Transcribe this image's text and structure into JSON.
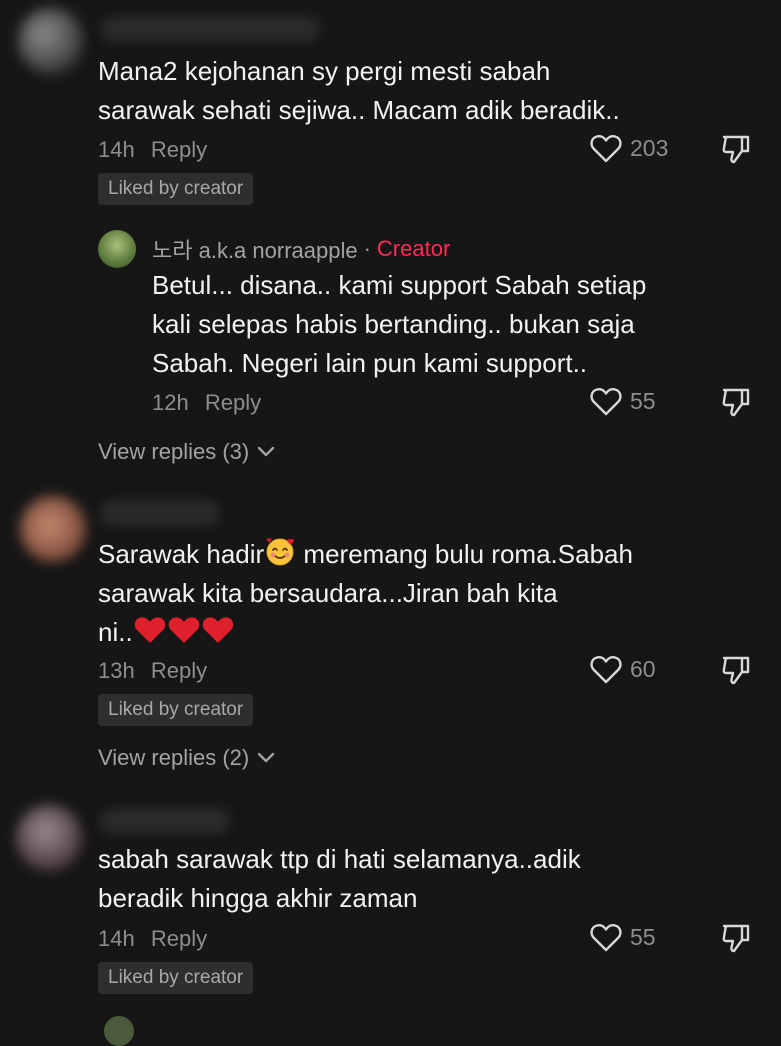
{
  "comments": [
    {
      "text_lines": [
        "Mana2 kejohanan sy pergi mesti sabah",
        "sarawak sehati sejiwa.. Macam adik beradik.."
      ],
      "time": "14h",
      "reply_label": "Reply",
      "likes": "203",
      "badge": "Liked by creator"
    },
    {
      "text_line_1_pre": "Sarawak hadir",
      "text_line_1_post": " meremang bulu roma.Sabah",
      "text_line_2": "sarawak kita bersaudara...Jiran bah kita",
      "text_line_3": "ni..",
      "time": "13h",
      "reply_label": "Reply",
      "likes": "60",
      "badge": "Liked by creator",
      "view_replies": "View replies (2)"
    },
    {
      "text_lines": [
        "sabah sarawak ttp di hati selamanya..adik",
        "beradik hingga akhir zaman"
      ],
      "time": "14h",
      "reply_label": "Reply",
      "likes": "55",
      "badge": "Liked by creator"
    }
  ],
  "reply": {
    "author": "노라 a.k.a norraapple",
    "separator": "·",
    "role": "Creator",
    "text_lines": [
      "Betul... disana.. kami support Sabah setiap",
      "kali selepas habis bertanding.. bukan saja",
      "Sabah. Negeri lain pun kami support.."
    ],
    "time": "12h",
    "reply_label": "Reply",
    "likes": "55",
    "view_replies": "View replies (3)"
  },
  "icons": {
    "like": "heart-outline-icon",
    "dislike": "thumb-down-icon",
    "chevron": "chevron-down-icon",
    "emoji_blush": "smiling-face-with-hearts-icon",
    "heart": "red-heart-icon"
  },
  "colors": {
    "background": "#161616",
    "creator_tag": "#fe2c55",
    "heart_red": "#e0202c"
  }
}
